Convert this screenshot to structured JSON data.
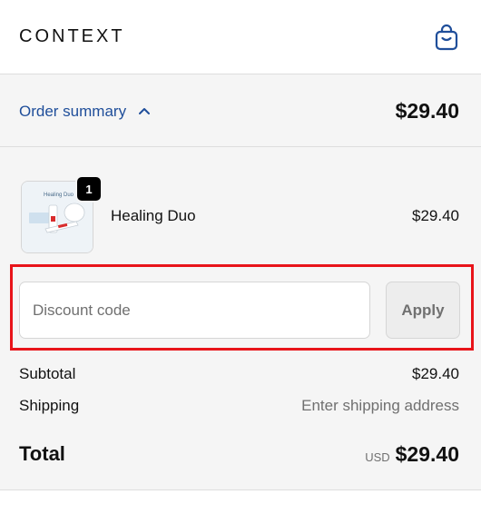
{
  "header": {
    "brand": "CONTEXT",
    "cart_icon": "shopping-bag-icon"
  },
  "summary_bar": {
    "label": "Order summary",
    "toggle_icon": "chevron-up-icon",
    "total": "$29.40"
  },
  "line_items": [
    {
      "name": "Healing Duo",
      "quantity": "1",
      "price": "$29.40",
      "thumbnail_label": "Healing Duo"
    }
  ],
  "discount": {
    "placeholder": "Discount code",
    "value": "",
    "apply_label": "Apply"
  },
  "totals": {
    "subtotal_label": "Subtotal",
    "subtotal_value": "$29.40",
    "shipping_label": "Shipping",
    "shipping_value": "Enter shipping address",
    "total_label": "Total",
    "currency": "USD",
    "total_value": "$29.40"
  },
  "colors": {
    "accent": "#1f4e9a",
    "highlight": "#e8141a",
    "panel_bg": "#f5f5f5"
  }
}
